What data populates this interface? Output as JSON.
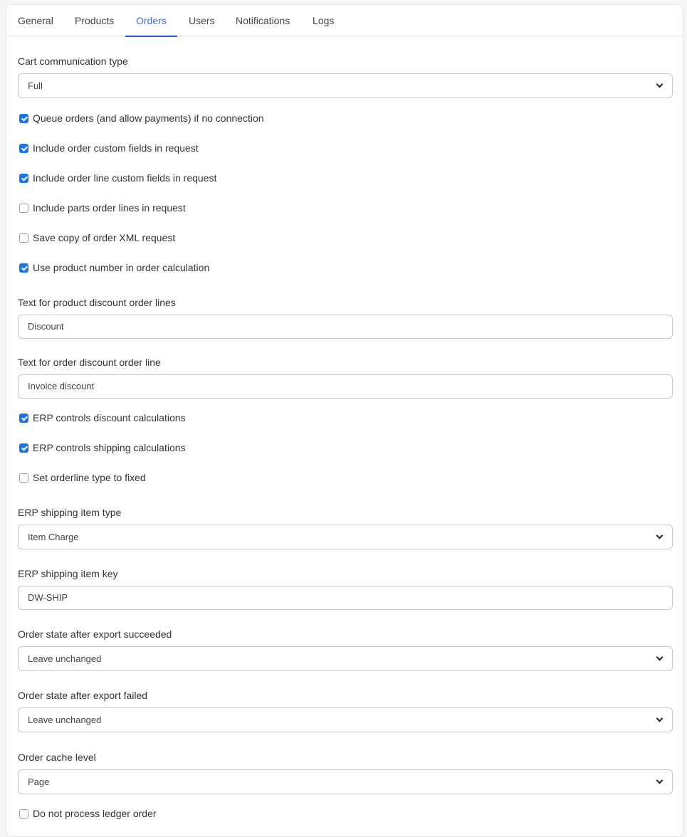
{
  "tabs": [
    {
      "label": "General",
      "active": false
    },
    {
      "label": "Products",
      "active": false
    },
    {
      "label": "Orders",
      "active": true
    },
    {
      "label": "Users",
      "active": false
    },
    {
      "label": "Notifications",
      "active": false
    },
    {
      "label": "Logs",
      "active": false
    }
  ],
  "colors": {
    "accent": "#2157d6",
    "active_tab_text": "#3b6fd8",
    "checkbox_checked": "#1a73e8"
  },
  "form": {
    "cart_communication_type": {
      "label": "Cart communication type",
      "value": "Full"
    },
    "checkboxes_1": [
      {
        "label": "Queue orders (and allow payments) if no connection",
        "checked": true
      },
      {
        "label": "Include order custom fields in request",
        "checked": true
      },
      {
        "label": "Include order line custom fields in request",
        "checked": true
      },
      {
        "label": "Include parts order lines in request",
        "checked": false
      },
      {
        "label": "Save copy of order XML request",
        "checked": false
      },
      {
        "label": "Use product number in order calculation",
        "checked": true
      }
    ],
    "product_discount_text": {
      "label": "Text for product discount order lines",
      "value": "Discount"
    },
    "order_discount_text": {
      "label": "Text for order discount order line",
      "value": "Invoice discount"
    },
    "checkboxes_2": [
      {
        "label": "ERP controls discount calculations",
        "checked": true
      },
      {
        "label": "ERP controls shipping calculations",
        "checked": true
      },
      {
        "label": "Set orderline type to fixed",
        "checked": false
      }
    ],
    "erp_shipping_item_type": {
      "label": "ERP shipping item type",
      "value": "Item Charge"
    },
    "erp_shipping_item_key": {
      "label": "ERP shipping item key",
      "value": "DW-SHIP"
    },
    "order_state_succeeded": {
      "label": "Order state after export succeeded",
      "value": "Leave unchanged"
    },
    "order_state_failed": {
      "label": "Order state after export failed",
      "value": "Leave unchanged"
    },
    "order_cache_level": {
      "label": "Order cache level",
      "value": "Page"
    },
    "checkboxes_3": [
      {
        "label": "Do not process ledger order",
        "checked": false
      }
    ]
  }
}
